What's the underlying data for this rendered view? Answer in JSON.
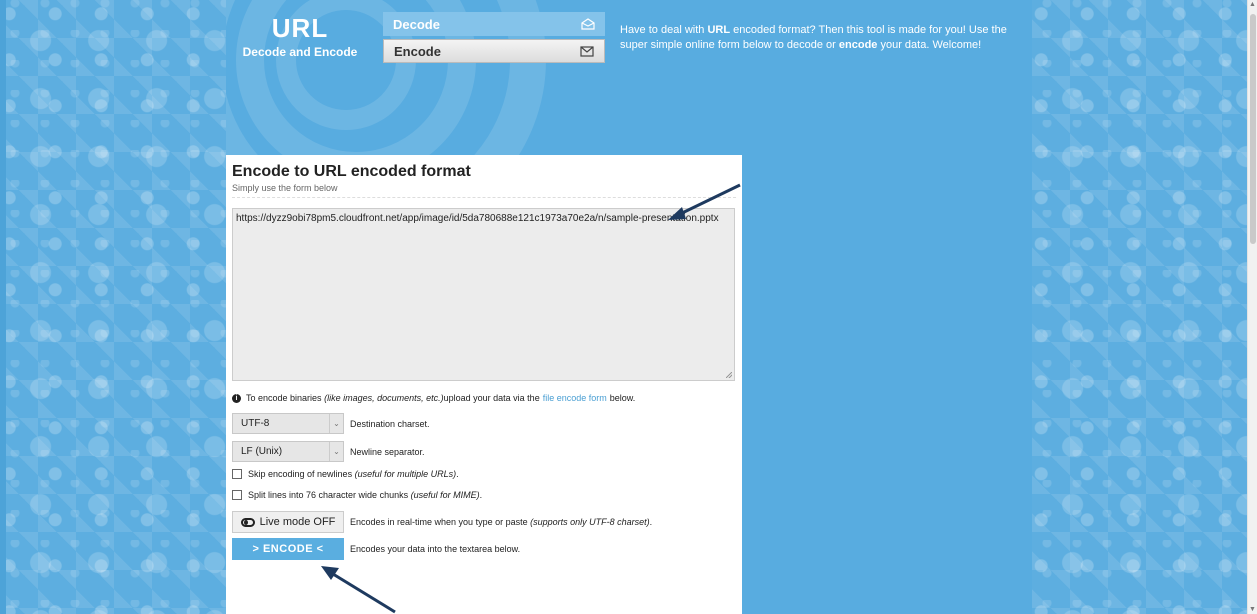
{
  "logo": {
    "title": "URL",
    "subtitle": "Decode and Encode"
  },
  "nav": {
    "decode_label": "Decode",
    "encode_label": "Encode"
  },
  "intro": {
    "part1": "Have to deal with ",
    "bold1": "URL",
    "part2": " encoded format? Then this tool is made for you! Use the super simple online form below to decode or ",
    "bold2": "encode",
    "part3": " your data. Welcome!"
  },
  "card": {
    "title": "Encode to URL encoded format",
    "subtitle": "Simply use the form below",
    "textarea_value": "https://dyzz9obi78pm5.cloudfront.net/app/image/id/5da780688e121c1973a70e2a/n/sample-presentation.pptx"
  },
  "binaries_note": {
    "text1": "To encode binaries ",
    "italic": "(like images, documents, etc.)",
    "text2": " upload your data via the",
    "link": "file encode form",
    "text3": "below."
  },
  "charset": {
    "selected": "UTF-8",
    "label": "Destination charset."
  },
  "newline": {
    "selected": "LF (Unix)",
    "label": "Newline separator."
  },
  "skip_newlines": {
    "text": "Skip encoding of newlines ",
    "italic": "(useful for multiple URLs)",
    "end": "."
  },
  "split_lines": {
    "text": "Split lines into 76 character wide chunks ",
    "italic": "(useful for MIME)",
    "end": "."
  },
  "live_mode": {
    "button": "Live mode OFF",
    "text": "Encodes in real-time when you type or paste ",
    "italic": "(supports only UTF-8 charset)",
    "end": "."
  },
  "encode": {
    "button": "> ENCODE <",
    "text": "Encodes your data into the textarea below."
  },
  "colors": {
    "accent": "#5aaee0",
    "link": "#4a9fd3",
    "arrow": "#1e3a5f"
  }
}
